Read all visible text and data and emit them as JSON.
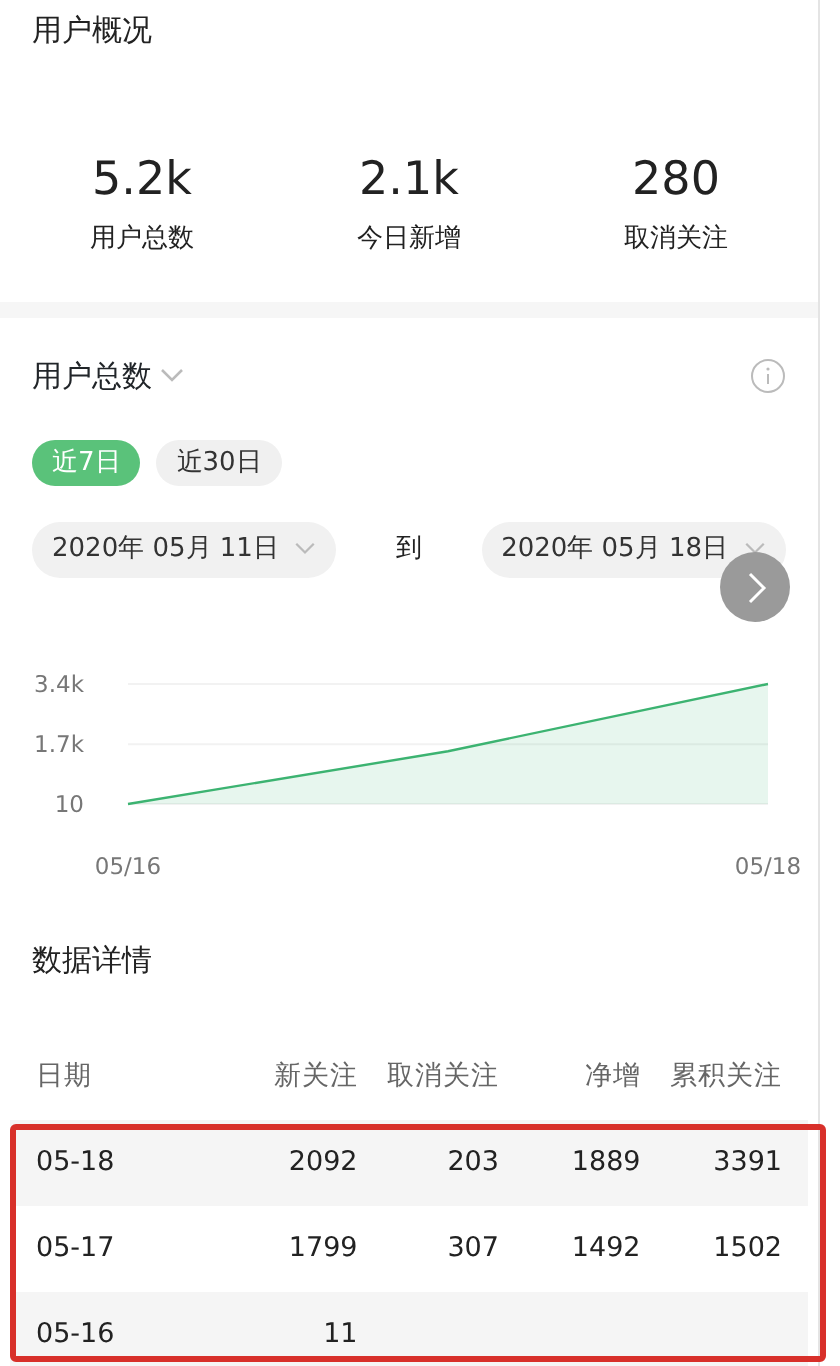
{
  "overview": {
    "title": "用户概况",
    "stats": [
      {
        "value": "5.2k",
        "label": "用户总数"
      },
      {
        "value": "2.1k",
        "label": "今日新增"
      },
      {
        "value": "280",
        "label": "取消关注"
      }
    ]
  },
  "trend": {
    "metric": "用户总数",
    "ranges": [
      {
        "label": "近7日",
        "selected": true
      },
      {
        "label": "近30日",
        "selected": false
      }
    ],
    "start_date": "2020年 05月 11日",
    "separator": "到",
    "end_date": "2020年 05月 18日",
    "chart_data": {
      "type": "area",
      "categories": [
        "05/16",
        null,
        "05/18"
      ],
      "series": [
        {
          "color": "#3cb371",
          "values": [
            10,
            1500,
            3400
          ]
        }
      ],
      "ylim": [
        10,
        3400
      ],
      "yticks": [
        {
          "value": 10,
          "label": "10"
        },
        {
          "value": 1700,
          "label": "1.7k"
        },
        {
          "value": 3400,
          "label": "3.4k"
        }
      ]
    }
  },
  "details": {
    "title": "数据详情",
    "columns": [
      "日期",
      "新关注",
      "取消关注",
      "净增",
      "累积关注"
    ],
    "rows": [
      [
        "05-18",
        "2092",
        "203",
        "1889",
        "3391"
      ],
      [
        "05-17",
        "1799",
        "307",
        "1492",
        "1502"
      ],
      [
        "05-16",
        "11"
      ]
    ],
    "annotation": {
      "color": "#d8302a"
    }
  }
}
